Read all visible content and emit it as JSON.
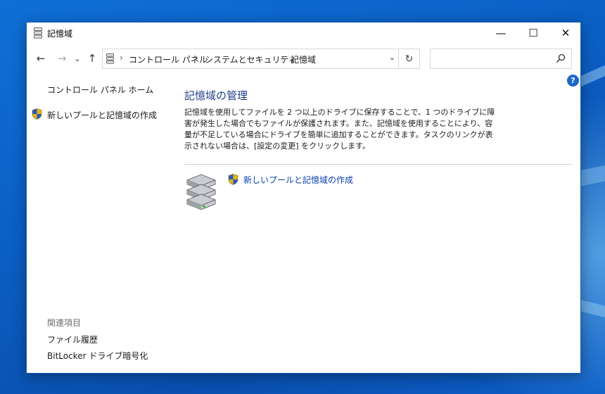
{
  "window": {
    "title": "記憶域"
  },
  "controls": {
    "minimize": "—",
    "maximize": "☐",
    "close": "✕"
  },
  "nav": {
    "back": "←",
    "forward": "→",
    "recent": "⌄",
    "up": "↑"
  },
  "address": {
    "crumbs": [
      "コントロール パネル",
      "システムとセキュリティ",
      "記憶域"
    ],
    "separator": "›",
    "dropdown": "⌄",
    "refresh": "↻"
  },
  "search": {
    "value": "",
    "placeholder": ""
  },
  "help": "?",
  "sidebar": {
    "home_link": "コントロール パネル ホーム",
    "create_link": "新しいプールと記憶域の作成",
    "related_heading": "関連項目",
    "related_links": [
      "ファイル履歴",
      "BitLocker ドライブ暗号化"
    ]
  },
  "main": {
    "title": "記憶域の管理",
    "description": "記憶域を使用してファイルを 2 つ以上のドライブに保存することで、1 つのドライブに障害が発生した場合でもファイルが保護されます。また、記憶域を使用することにより、容量が不足している場合にドライブを簡単に追加することができます。タスクのリンクが表示されない場合は、[設定の変更] をクリックします。",
    "create_link": "新しいプールと記憶域の作成"
  },
  "colors": {
    "accent": "#1e3c8c",
    "link": "#0b3fb0",
    "window_border": "#1a5fb4"
  }
}
